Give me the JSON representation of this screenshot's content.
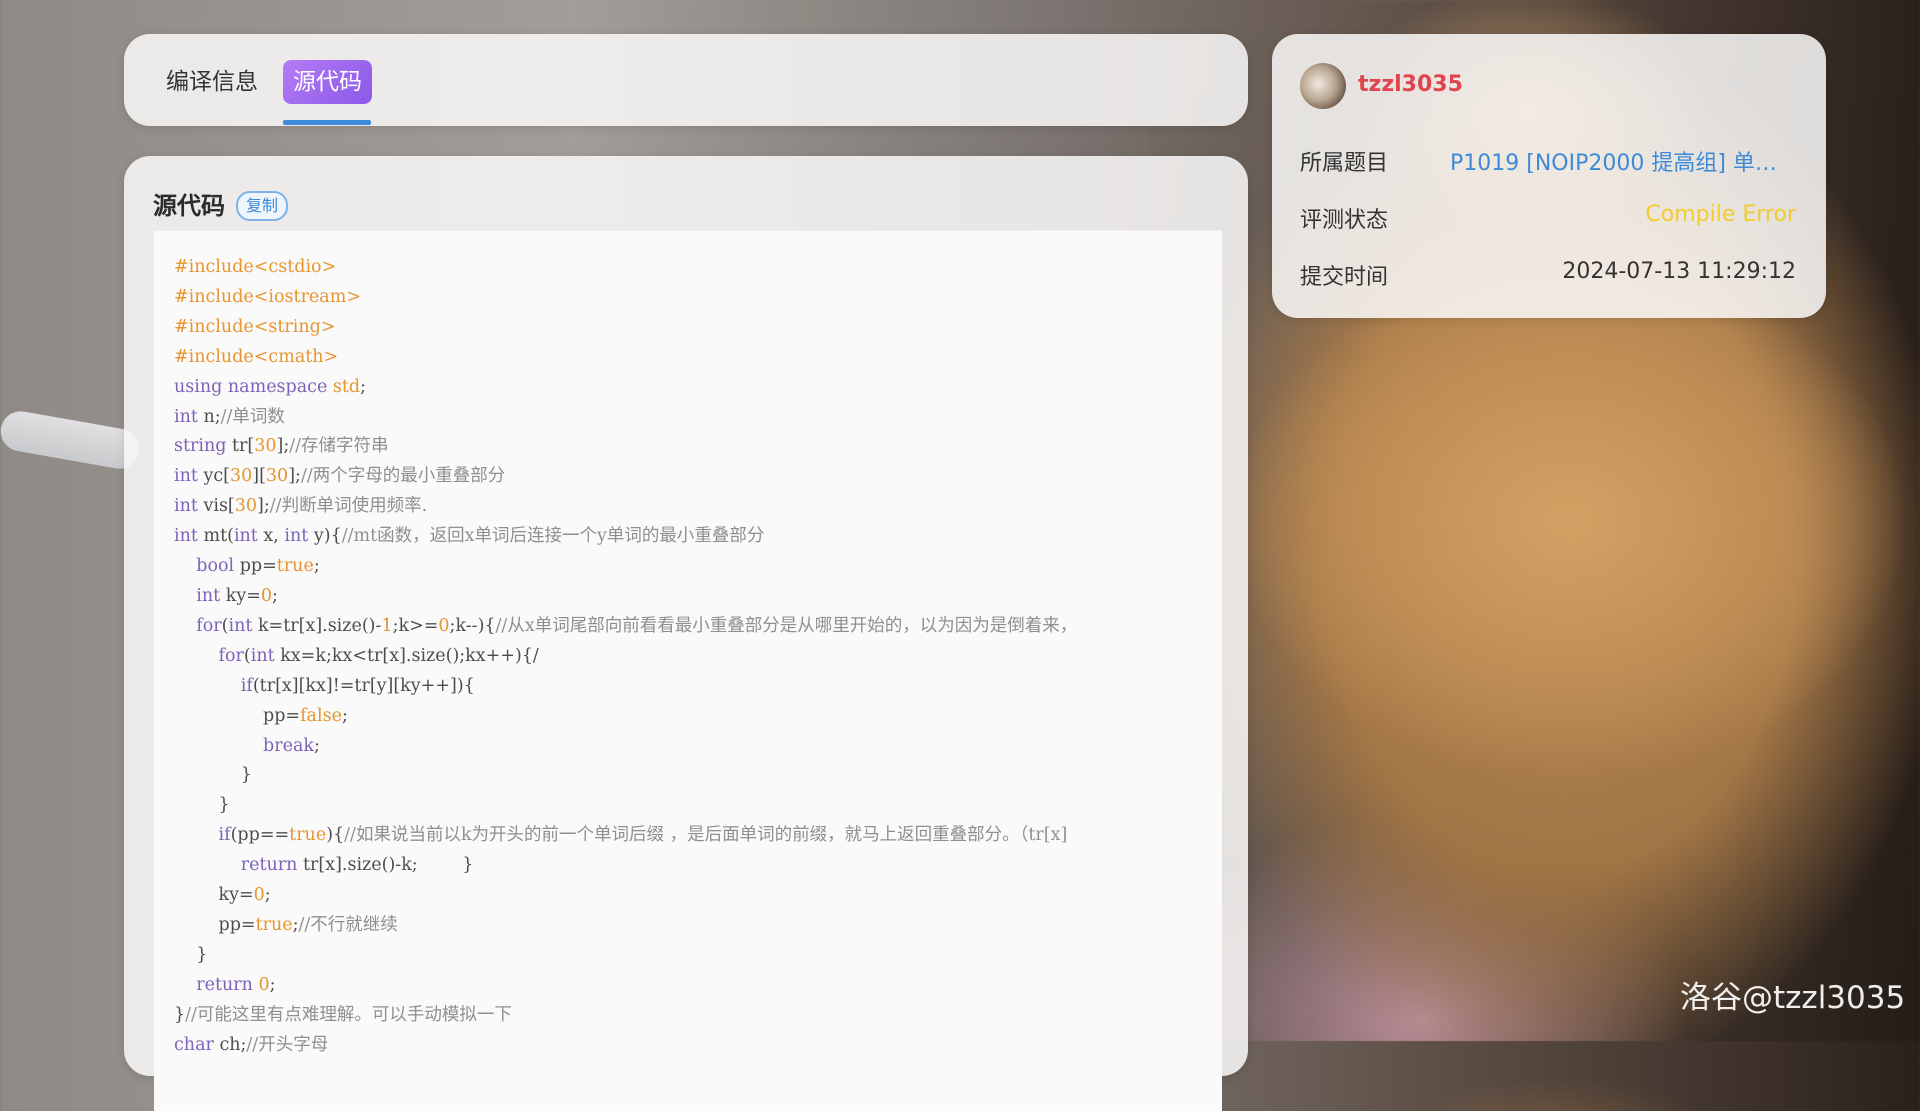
{
  "tabs": [
    {
      "label": "编译信息"
    },
    {
      "label": "源代码"
    }
  ],
  "source": {
    "title": "源代码",
    "copy_label": "复制",
    "code_lines": [
      "#include<cstdio>",
      "#include<iostream>",
      "#include<string>",
      "#include<cmath>",
      "using namespace std;",
      "int n;//单词数",
      "string tr[30];//存储字符串",
      "int yc[30][30];//两个字母的最小重叠部分",
      "int vis[30];//判断单词使用频率.",
      "int mt(int x, int y){//mt函数，返回x单词后连接一个y单词的最小重叠部分",
      "    bool pp=true;",
      "    int ky=0;",
      "    for(int k=tr[x].size()-1;k>=0;k--){//从x单词尾部向前看看最小重叠部分是从哪里开始的，以为因为是倒着来，",
      "        for(int kx=k;kx<tr[x].size();kx++){/",
      "            if(tr[x][kx]!=tr[y][ky++]){",
      "                pp=false;",
      "                break;",
      "            }",
      "        }",
      "        if(pp==true){//如果说当前以k为开头的前一个单词后缀 ，是后面单词的前缀，就马上返回重叠部分。（tr[x]",
      "            return tr[x].size()-k;        }",
      "        ky=0;",
      "        pp=true;//不行就继续",
      "    }",
      "    return 0;",
      "}//可能这里有点难理解。可以手动模拟一下",
      "char ch;//开头字母"
    ]
  },
  "info": {
    "username": "tzzl3035",
    "problem_label": "所属题目",
    "problem_value": "P1019 [NOIP2000 提高组] 单词…",
    "status_label": "评测状态",
    "status_value": "Compile Error",
    "time_label": "提交时间",
    "time_value": "2024-07-13 11:29:12"
  },
  "watermark": "洛谷@tzzl3035",
  "colors": {
    "accent": "#8b59e8",
    "link": "#3d8bd8",
    "username": "#e0444e",
    "status": "#f2cc2f"
  }
}
